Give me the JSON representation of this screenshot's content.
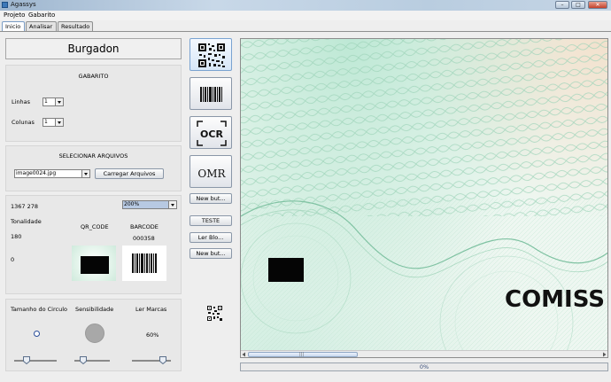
{
  "window": {
    "title": "Agassys",
    "min_label": "–",
    "max_label": "□",
    "close_label": "✕"
  },
  "menu": [
    "Projeto",
    "Gabarito"
  ],
  "tabs": [
    {
      "label": "Inicio",
      "active": true
    },
    {
      "label": "Analisar",
      "active": false
    },
    {
      "label": "Resultado",
      "active": false
    }
  ],
  "header": {
    "title": "Burgadon"
  },
  "gabarito": {
    "title": "GABARITO",
    "linhas_label": "Linhas",
    "linhas_value": "1",
    "colunas_label": "Colunas",
    "colunas_value": "1"
  },
  "arquivos": {
    "title": "SELECIONAR ARQUIVOS",
    "file_value": "image0024.jpg",
    "load_button": "Carregar Arquivos"
  },
  "info": {
    "coords": "1367 278",
    "zoom_value": "200%",
    "tonalidade_label": "Tonalidade",
    "tonalidade_value": "180",
    "zero_value": "0",
    "qr_label": "QR_CODE",
    "barcode_label": "BARCODE",
    "barcode_value": "000358"
  },
  "controls": {
    "circle_label": "Tamanho do Circulo",
    "sens_label": "Sensibilidade",
    "marks_label": "Ler Marcas",
    "marks_value": "60%",
    "circle_slider": 0.25,
    "sens_slider": 0.2,
    "marks_slider": 0.85
  },
  "tools": {
    "ocr_label": "OCR",
    "omr_label": "OMR",
    "new_button_1": "New but...",
    "teste_button": "TESTE",
    "ler_button": "Ler Blo...",
    "new_button_2": "New but..."
  },
  "canvas": {
    "text": "COMISS"
  },
  "progress": {
    "label": "0%",
    "value": 0
  },
  "colors": {
    "accent": "#7aa3d1",
    "panel": "#e8e8e8",
    "canvas_green": "#bfe6d2",
    "progress_text": "#3a4f7a"
  }
}
